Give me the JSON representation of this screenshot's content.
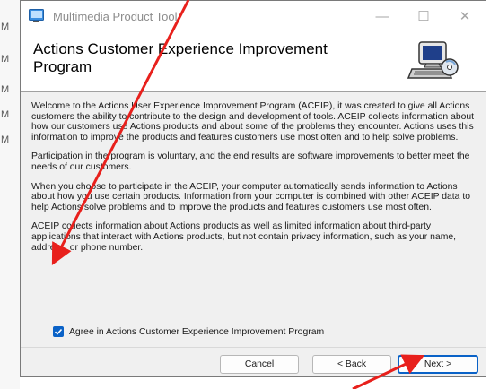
{
  "window": {
    "title": "Multimedia Product Tool",
    "controls": {
      "minimize": "—",
      "maximize": "☐",
      "close": "✕"
    }
  },
  "header": {
    "title": "Actions Customer Experience Improvement Program"
  },
  "body": {
    "paragraphs": [
      "Welcome to the Actions User Experience Improvement Program (ACEIP), it was created to give all Actions customers the ability to contribute to the design and development of tools. ACEIP collects information about how our customers use Actions products and about some of the problems they encounter. Actions uses this information to improve the products and features customers use most often and to help solve problems.",
      "Participation in the program is voluntary, and the end results are software improvements to better meet the needs of our customers.",
      "When you choose to participate in the ACEIP, your computer automatically sends information to Actions about how you use certain products. Information from your computer is combined with other ACEIP data to help Actions solve problems and to improve the products and features customers use most often.",
      "ACEIP collects information about Actions products as well as limited information about third-party applications that interact with Actions products, but not contain privacy information, such as your name, address, or phone number."
    ]
  },
  "agree": {
    "label": "Agree in Actions Customer Experience Improvement Program",
    "checked": true
  },
  "buttons": {
    "cancel": "Cancel",
    "back": "< Back",
    "next": "Next >"
  },
  "background": {
    "edge_letters": [
      "M",
      "M",
      "M",
      "M",
      "M"
    ]
  },
  "colors": {
    "accent": "#0a62c7",
    "annotation_arrow": "#e8201c"
  }
}
